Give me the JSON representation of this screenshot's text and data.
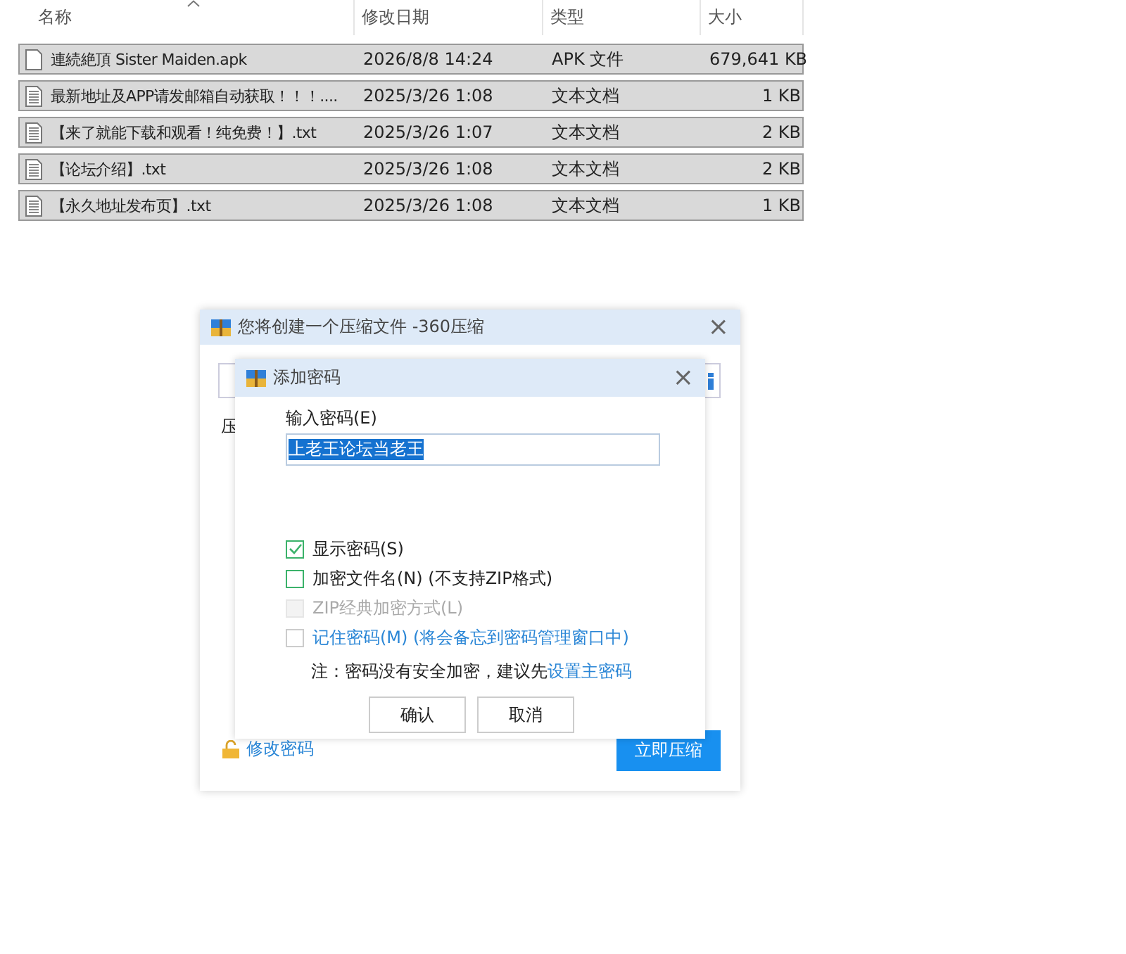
{
  "explorer": {
    "columns": [
      "名称",
      "修改日期",
      "类型",
      "大小"
    ],
    "files": [
      {
        "kind": "apk",
        "name": "連続絶頂 Sister Maiden.apk",
        "date": "2026/8/8 14:24",
        "type": "APK 文件",
        "size": "679,641 KB",
        "selected": true
      },
      {
        "kind": "txt",
        "name": "最新地址及APP请发邮箱自动获取！！！....",
        "date": "2025/3/26 1:08",
        "type": "文本文档",
        "size": "1 KB",
        "selected": true
      },
      {
        "kind": "txt",
        "name": "【来了就能下载和观看！纯免费！】.txt",
        "date": "2025/3/26 1:07",
        "type": "文本文档",
        "size": "2 KB",
        "selected": true
      },
      {
        "kind": "txt",
        "name": "【论坛介绍】.txt",
        "date": "2025/3/26 1:08",
        "type": "文本文档",
        "size": "2 KB",
        "selected": true
      },
      {
        "kind": "txt",
        "name": "【永久地址发布页】.txt",
        "date": "2025/3/26 1:08",
        "type": "文本文档",
        "size": "1 KB",
        "selected": true
      }
    ]
  },
  "compress_dialog": {
    "title": "您将创建一个压缩文件 -360压缩",
    "close": "×",
    "label": "压",
    "change_password": "修改密码",
    "start_button": "立即压缩"
  },
  "password_dialog": {
    "title": "添加密码",
    "close": "×",
    "password_label": "输入密码(E)",
    "password_value": "上老王论坛当老王",
    "options": [
      {
        "kind": "plain",
        "label": "显示密码(S)",
        "checked": true,
        "disabled": false
      },
      {
        "kind": "plain",
        "label": "加密文件名(N) (不支持ZIP格式)",
        "checked": false,
        "disabled": false
      },
      {
        "kind": "plain",
        "label": "ZIP经典加密方式(L)",
        "checked": false,
        "disabled": true
      },
      {
        "kind": "link",
        "label": "记住密码(M) (将会备忘到密码管理窗口中)",
        "checked": false,
        "disabled": false
      }
    ],
    "note": "注：密码没有安全加密，建议先",
    "note_link": "设置主密码",
    "buttons": [
      "确认",
      "取消"
    ]
  }
}
